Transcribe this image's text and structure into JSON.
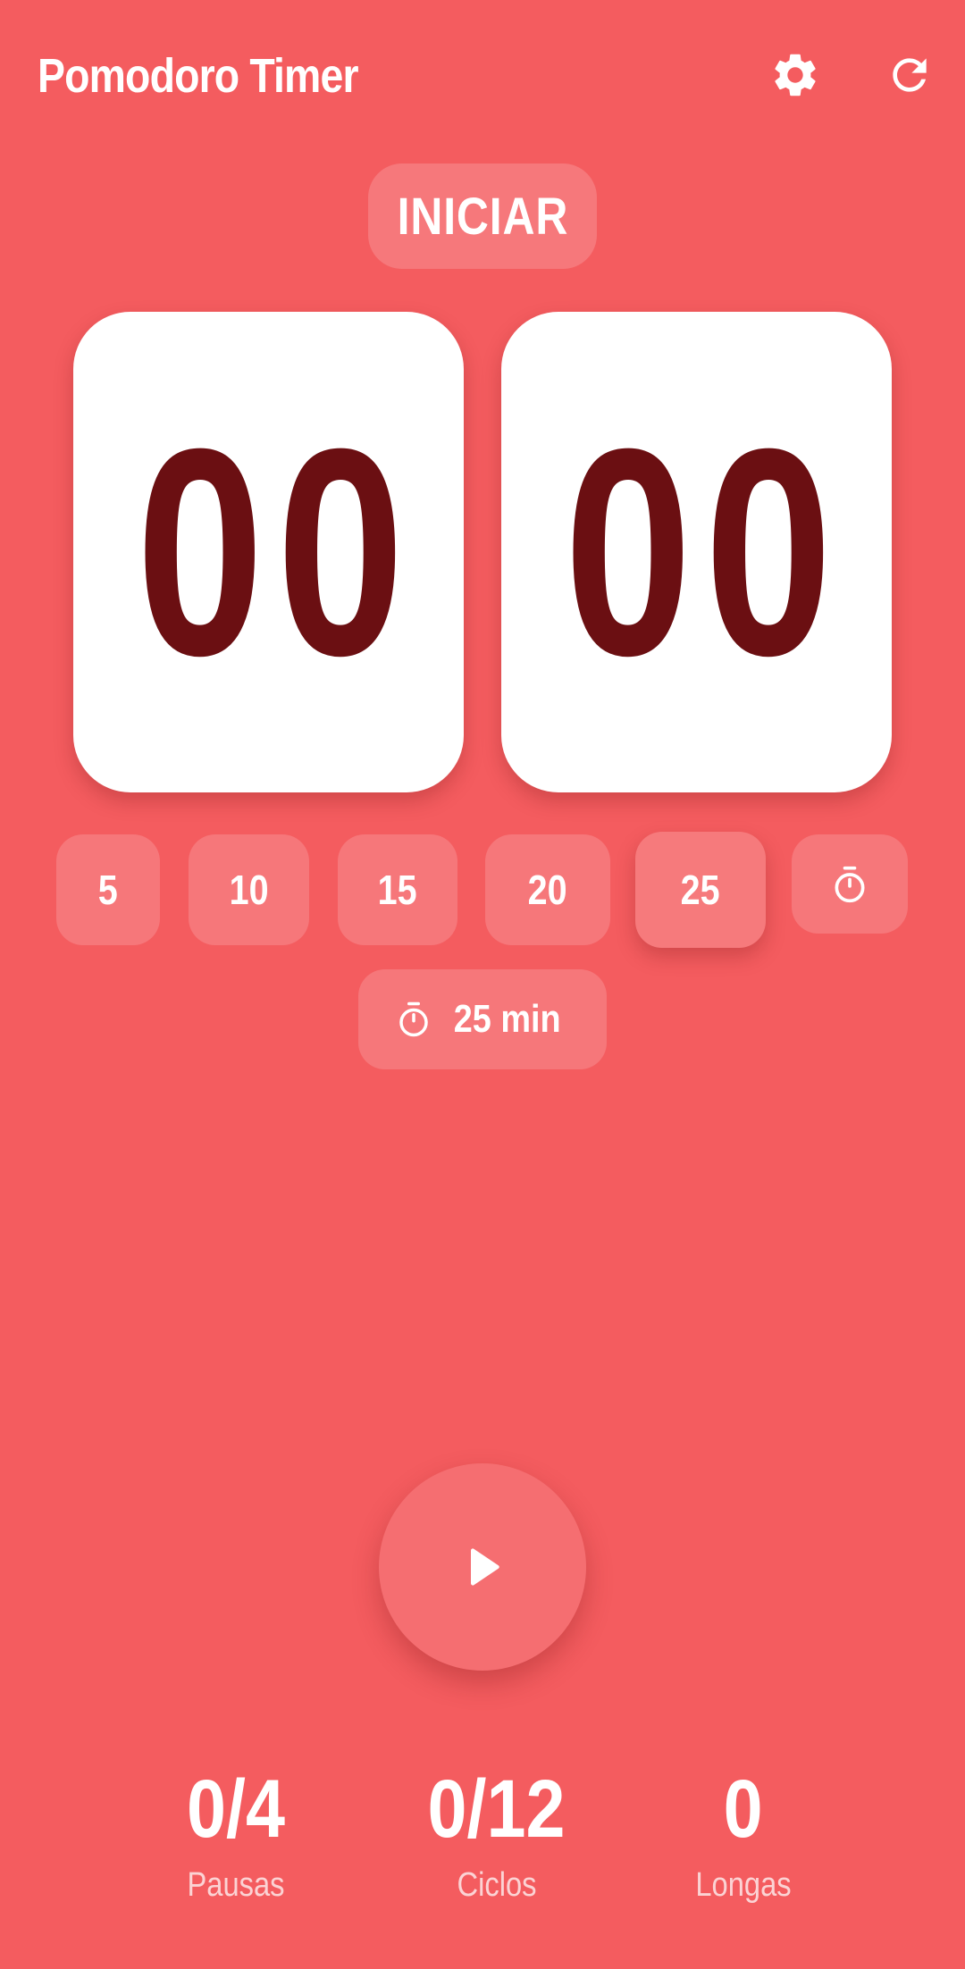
{
  "header": {
    "title": "Pomodoro Timer",
    "settings_icon": "gear-icon",
    "reset_icon": "refresh-icon"
  },
  "start_label": "INICIAR",
  "timer": {
    "minutes": "00",
    "seconds": "00"
  },
  "presets": [
    {
      "label": "5"
    },
    {
      "label": "10"
    },
    {
      "label": "15"
    },
    {
      "label": "20"
    },
    {
      "label": "25",
      "selected": true
    }
  ],
  "custom_icon": "stopwatch-icon",
  "duration_chip": {
    "icon": "stopwatch-icon",
    "label": "25 min"
  },
  "play_icon": "play-icon",
  "stats": [
    {
      "value": "0/4",
      "label": "Pausas"
    },
    {
      "value": "0/12",
      "label": "Ciclos"
    },
    {
      "value": "0",
      "label": "Longas"
    }
  ],
  "colors": {
    "background": "#f45c5f",
    "button": "#f6777a",
    "card": "#ffffff",
    "digits": "#6b0f12",
    "text": "#ffffff",
    "muted_text": "#fbd3d4"
  }
}
